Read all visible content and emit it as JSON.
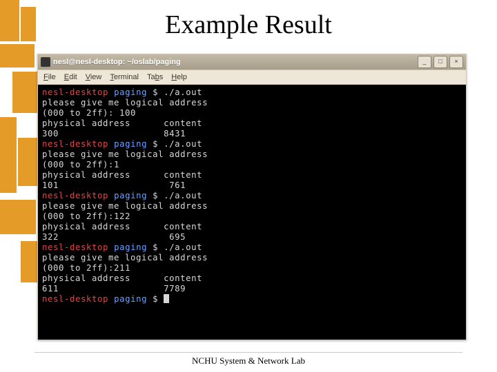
{
  "slide": {
    "title": "Example Result",
    "footer": "NCHU System & Network Lab"
  },
  "window": {
    "title": "nesl@nesl-desktop: ~/oslab/paging",
    "min_tip": "Minimize",
    "max_tip": "Maximize",
    "close_tip": "Close"
  },
  "menu": {
    "file": "File",
    "edit": "Edit",
    "view": "View",
    "terminal": "Terminal",
    "tabs": "Tabs",
    "help": "Help"
  },
  "prompt": {
    "host": "nesl-desktop",
    "dir": "paging",
    "sep": " $ "
  },
  "runs": [
    {
      "cmd": "./a.out",
      "ask": "please give me logical address",
      "range_label": "(000 to 2ff): ",
      "input": "100",
      "hdr_addr": "physical address",
      "hdr_content": "content",
      "addr": "300",
      "content": "8431"
    },
    {
      "cmd": "./a.out",
      "ask": "please give me logical address",
      "range_label": "(000 to 2ff):",
      "input": "1",
      "hdr_addr": "physical address",
      "hdr_content": "content",
      "addr": "101",
      "content": "761"
    },
    {
      "cmd": "./a.out",
      "ask": "please give me logical address",
      "range_label": "(000 to 2ff):",
      "input": "122",
      "hdr_addr": "physical address",
      "hdr_content": "content",
      "addr": "322",
      "content": "695"
    },
    {
      "cmd": "./a.out",
      "ask": "please give me logical address",
      "range_label": "(000 to 2ff):",
      "input": "211",
      "hdr_addr": "physical address",
      "hdr_content": "content",
      "addr": "611",
      "content": "7789"
    }
  ],
  "icons": {
    "min": "_",
    "max": "□",
    "close": "×"
  }
}
